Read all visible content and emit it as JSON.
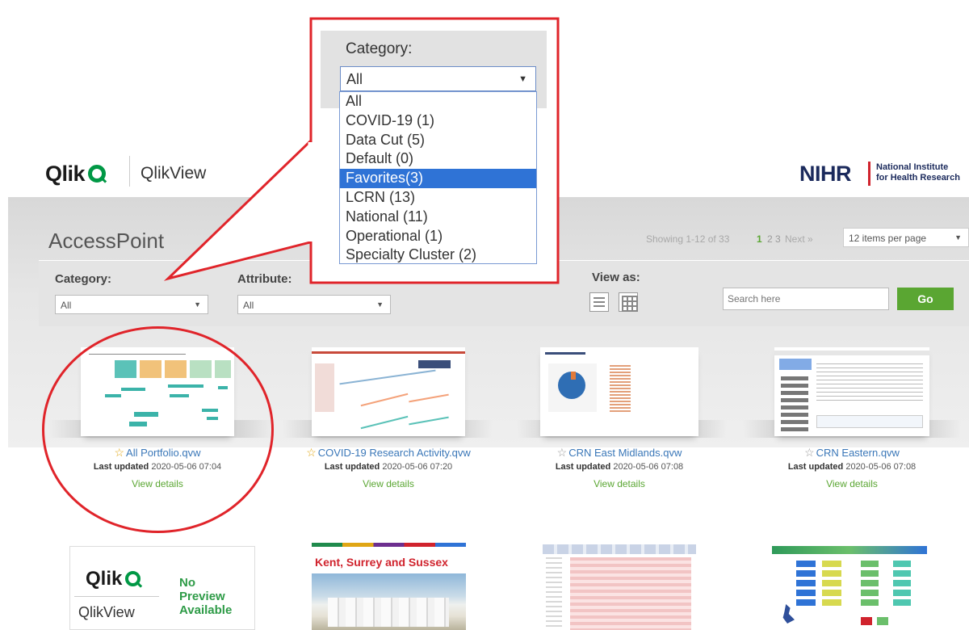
{
  "header": {
    "qlik_logo": "Qlik",
    "product": "QlikView",
    "org_logo": "NIHR",
    "org_name_line1": "National Institute",
    "org_name_line2": "for Health Research"
  },
  "accesspoint": {
    "title": "AccessPoint",
    "showing": "Showing 1-12 of 33",
    "pages": [
      "1",
      "2",
      "3"
    ],
    "next": "Next »",
    "per_page": "12 items per page"
  },
  "filters": {
    "category_label": "Category:",
    "category_value": "All",
    "attribute_label": "Attribute:",
    "attribute_value": "All",
    "view_as_label": "View as:",
    "search_placeholder": "Search here",
    "go_label": "Go"
  },
  "dropdown_zoom": {
    "label": "Category:",
    "selected_value": "All",
    "options": [
      "All",
      "COVID-19 (1)",
      "Data Cut (5)",
      "Default (0)",
      "Favorites(3)",
      "LCRN (13)",
      "National (11)",
      "Operational (1)",
      "Specialty Cluster (2)"
    ],
    "highlighted_index": 4
  },
  "documents": [
    {
      "title": "All Portfolio.qvw",
      "favorite": true,
      "updated_label": "Last updated",
      "updated": "2020-05-06 07:04",
      "details": "View details"
    },
    {
      "title": "COVID-19 Research Activity.qvw",
      "favorite": true,
      "updated_label": "Last updated",
      "updated": "2020-05-06 07:20",
      "details": "View details"
    },
    {
      "title": "CRN East Midlands.qvw",
      "favorite": false,
      "updated_label": "Last updated",
      "updated": "2020-05-06 07:08",
      "details": "View details"
    },
    {
      "title": "CRN Eastern.qvw",
      "favorite": false,
      "updated_label": "Last updated",
      "updated": "2020-05-06 07:08",
      "details": "View details"
    }
  ],
  "row2": {
    "no_preview_logo": "Qlik",
    "no_preview_product": "QlikView",
    "no_preview_line1": "No",
    "no_preview_line2": "Preview",
    "no_preview_line3": "Available",
    "kss_title": "Kent, Surrey and Sussex"
  },
  "colors": {
    "accent_green": "#5aa632",
    "link_blue": "#3a77b8",
    "annotation_red": "#e0242a",
    "nihr_navy": "#1b2a5c"
  }
}
